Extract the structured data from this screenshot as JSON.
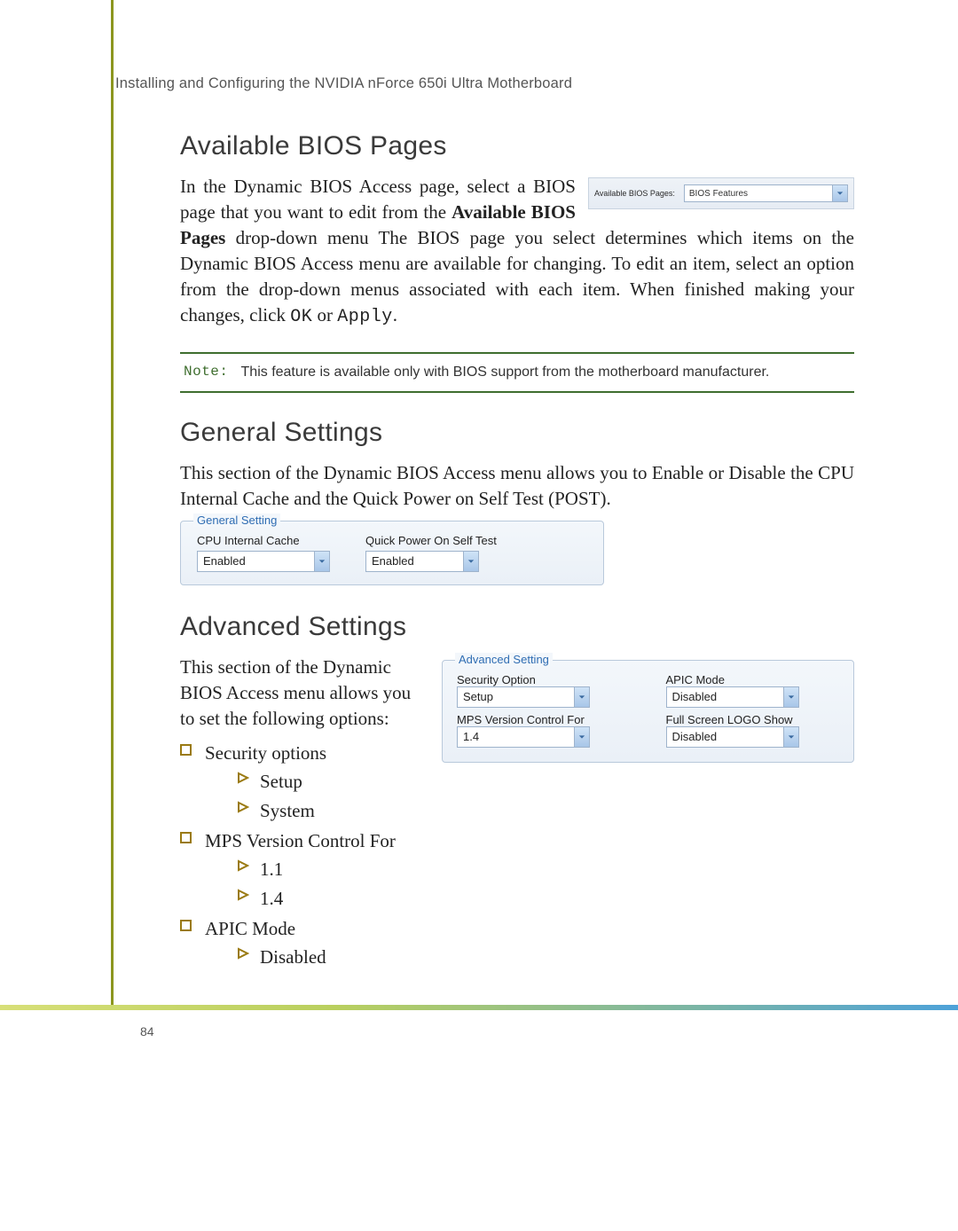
{
  "header": {
    "running_head": "Installing and Configuring the NVIDIA nForce 650i Ultra Motherboard"
  },
  "sections": {
    "available": {
      "title": "Available BIOS Pages",
      "intro_pre": "In the Dynamic BIOS Access page, select a BIOS page that you want to edit from the ",
      "intro_bold": "Available BIOS Pages",
      "intro_mid": " drop-down menu The BIOS page you select determines which items on the Dynamic BIOS Access menu are available for changing. To edit an item, select an option from the drop-down menus associated with each item. When finished making your changes, click ",
      "ok": "OK",
      "intro_or": " or ",
      "apply": "Apply",
      "intro_end": ".",
      "figure": {
        "label": "Available BIOS Pages:",
        "value": "BIOS Features"
      }
    },
    "note": {
      "label": "Note:",
      "text": "This feature is available only with BIOS support from the motherboard manufacturer."
    },
    "general": {
      "title": "General Settings",
      "body": "This section of the Dynamic BIOS Access menu allows you to Enable or Disable the CPU Internal Cache and the Quick Power on Self Test (POST).",
      "figure": {
        "legend": "General Setting",
        "cpu_label": "CPU Internal Cache",
        "cpu_value": "Enabled",
        "qp_label": "Quick Power On Self Test",
        "qp_value": "Enabled"
      }
    },
    "advanced": {
      "title": "Advanced Settings",
      "body": "This section of the Dynamic BIOS Access menu allows you to set the following options:",
      "figure": {
        "legend": "Advanced Setting",
        "sec_label": "Security Option",
        "sec_value": "Setup",
        "apic_label": "APIC Mode",
        "apic_value": "Disabled",
        "mps_label": "MPS Version Control For",
        "mps_value": "1.4",
        "logo_label": "Full Screen LOGO Show",
        "logo_value": "Disabled"
      },
      "bullets": {
        "b1": "Security options",
        "b1a": "Setup",
        "b1b": "System",
        "b2": "MPS Version Control For",
        "b2a": "1.1",
        "b2b": "1.4",
        "b3": "APIC Mode",
        "b3a": "Disabled"
      }
    }
  },
  "footer": {
    "page_number": "84"
  }
}
